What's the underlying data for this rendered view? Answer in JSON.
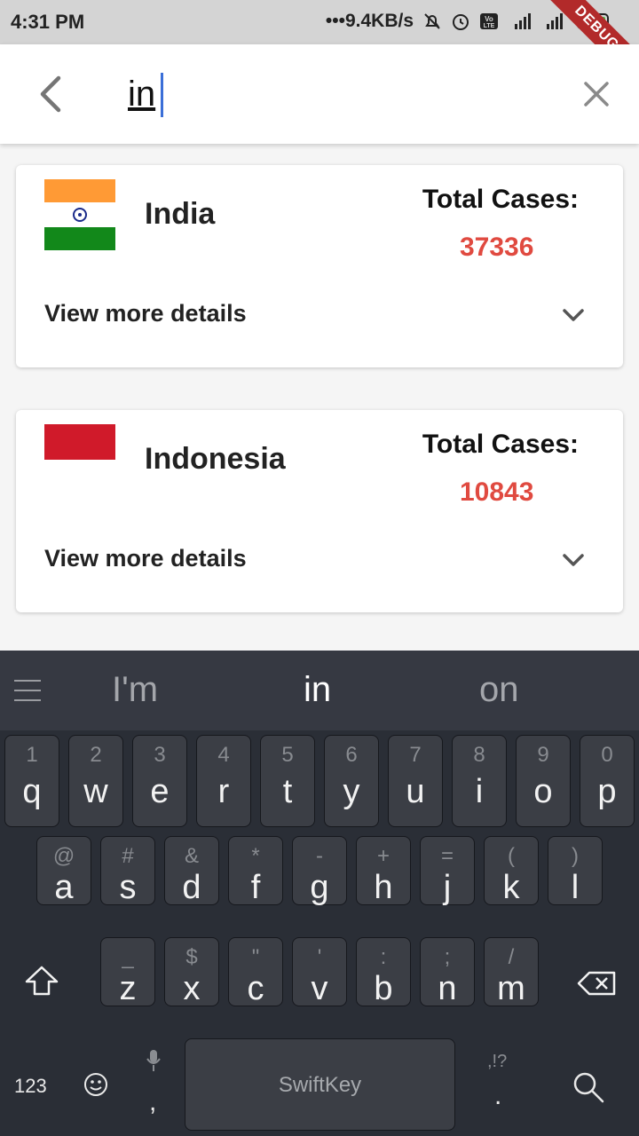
{
  "status": {
    "time": "4:31 PM",
    "net_speed": "•••9.4KB/s",
    "debug_label": "DEBUG"
  },
  "search": {
    "query": "in"
  },
  "card_label": {
    "total": "Total Cases:",
    "details": "View more details"
  },
  "results": [
    {
      "country": "India",
      "total_cases": "37336",
      "flag": "india-flag"
    },
    {
      "country": "Indonesia",
      "total_cases": "10843",
      "flag": "indonesia-flag"
    }
  ],
  "colors": {
    "accent": "#e04a40",
    "keyboard_bg": "#2a2e36",
    "key_bg": "#3b3e45"
  },
  "keyboard": {
    "suggestions": [
      "I'm",
      "in",
      "on"
    ],
    "row1": [
      {
        "sub": "1",
        "key": "q"
      },
      {
        "sub": "2",
        "key": "w"
      },
      {
        "sub": "3",
        "key": "e"
      },
      {
        "sub": "4",
        "key": "r"
      },
      {
        "sub": "5",
        "key": "t"
      },
      {
        "sub": "6",
        "key": "y"
      },
      {
        "sub": "7",
        "key": "u"
      },
      {
        "sub": "8",
        "key": "i"
      },
      {
        "sub": "9",
        "key": "o"
      },
      {
        "sub": "0",
        "key": "p"
      }
    ],
    "row2": [
      {
        "sub": "@",
        "key": "a"
      },
      {
        "sub": "#",
        "key": "s"
      },
      {
        "sub": "&",
        "key": "d"
      },
      {
        "sub": "*",
        "key": "f"
      },
      {
        "sub": "-",
        "key": "g"
      },
      {
        "sub": "+",
        "key": "h"
      },
      {
        "sub": "=",
        "key": "j"
      },
      {
        "sub": "(",
        "key": "k"
      },
      {
        "sub": ")",
        "key": "l"
      }
    ],
    "row3": [
      {
        "sub": "_",
        "key": "z"
      },
      {
        "sub": "$",
        "key": "x"
      },
      {
        "sub": "\"",
        "key": "c"
      },
      {
        "sub": "'",
        "key": "v"
      },
      {
        "sub": ":",
        "key": "b"
      },
      {
        "sub": ";",
        "key": "n"
      },
      {
        "sub": "/",
        "key": "m"
      }
    ],
    "num_label": "123",
    "comma": ",",
    "space_label": "SwiftKey",
    "punct_sub": ",!?",
    "period": "."
  }
}
